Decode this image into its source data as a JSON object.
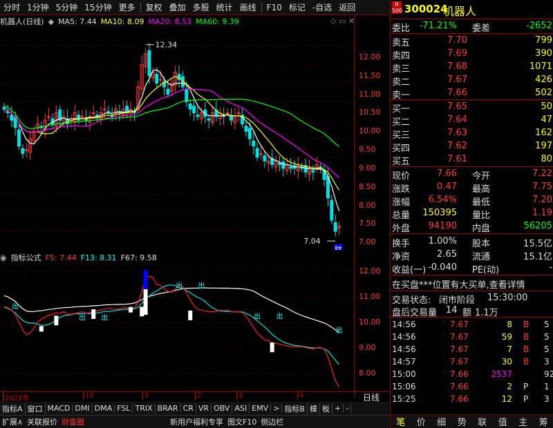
{
  "toolbar": {
    "items": [
      "分时",
      "1分钟",
      "5分钟",
      "15分钟",
      "更多",
      "复权",
      "叠加",
      "多股",
      "统计",
      "画线",
      "F10",
      "标记",
      "-自选",
      "返回"
    ]
  },
  "main_title": {
    "name": "机器人(日线)",
    "ma5": "MA5: 7.44",
    "ma10": "MA10: 8.09",
    "ma20": "MA20: 8.53",
    "ma60": "MA60: 9.39"
  },
  "annotations": {
    "high": "12.34",
    "low": "7.04",
    "cai": "财"
  },
  "ind_title": {
    "name": "指标公式",
    "f5": "F5: 7.44",
    "f13": "F13: 8.31",
    "f67": "F67: 9.58"
  },
  "chu": "出",
  "x_labels": [
    "2021年",
    "12",
    "1",
    "2",
    "3",
    "4"
  ],
  "daily": "日线",
  "tabs": [
    "指标A",
    "窗口",
    "MACD",
    "DMI",
    "DMA",
    "FSL",
    "TRIX",
    "BRAR",
    "CR",
    "VR",
    "OBV",
    "ASI",
    "EMV",
    ">",
    "指标B",
    "模",
    "板",
    "+",
    "-"
  ],
  "bottom": [
    "扩展∧",
    "关联报价",
    "财富圈",
    "新用户福利专享",
    "图文F10",
    "侧边栏"
  ],
  "colors": {
    "up": "#ff3c3c",
    "down": "#00e0e0",
    "ma5": "#ffffff",
    "ma10": "#ffff00",
    "ma20": "#ff00ff",
    "ma60": "#00ff00",
    "axis": "#ff3c3c",
    "blue": "#0000ff"
  },
  "chart_data": [
    {
      "type": "candlestick",
      "title": "机器人(日线)",
      "ylim": [
        6.8,
        12.8
      ],
      "y_ticks": [
        "12.00",
        "11.50",
        "11.00",
        "10.50",
        "10.00",
        "9.50",
        "9.00",
        "8.50",
        "8.00",
        "7.50",
        "7.00"
      ],
      "ma_labels": [
        "MA5: 7.44",
        "MA10: 8.09",
        "MA20: 8.53",
        "MA60: 9.39"
      ],
      "close": [
        10.6,
        10.5,
        10.3,
        10.1,
        9.6,
        9.4,
        9.5,
        9.8,
        10.0,
        10.2,
        10.1,
        10.3,
        10.4,
        10.2,
        10.5,
        10.3,
        10.4,
        10.2,
        10.3,
        10.5,
        10.3,
        10.4,
        10.3,
        10.4,
        10.5,
        10.4,
        10.5,
        10.6,
        10.5,
        10.4,
        10.6,
        10.5,
        10.6,
        10.5,
        10.6,
        10.5,
        11.2,
        11.8,
        12.1,
        11.5,
        11.6,
        11.3,
        11.4,
        11.2,
        11.0,
        11.3,
        11.6,
        11.4,
        11.2,
        10.8,
        10.6,
        10.5,
        10.4,
        10.5,
        10.4,
        10.3,
        10.5,
        10.4,
        10.5,
        10.4,
        10.5,
        10.3,
        10.4,
        10.5,
        10.2,
        10.0,
        9.8,
        9.6,
        9.3,
        9.4,
        9.2,
        9.2,
        9.1,
        9.2,
        9.1,
        9.0,
        9.1,
        9.0,
        9.0,
        9.1,
        9.0,
        8.9,
        9.0,
        8.9,
        9.1,
        9.0,
        8.7,
        8.2,
        7.6,
        7.3,
        7.44
      ]
    },
    {
      "type": "line",
      "title": "指标公式",
      "ylim": [
        7.3,
        12.3
      ],
      "y_ticks": [
        "12.00",
        "11.00",
        "10.00",
        "9.00",
        "8.00"
      ],
      "series": [
        {
          "name": "F5: 7.44"
        },
        {
          "name": "F13: 8.31"
        },
        {
          "name": "F67: 9.58"
        }
      ]
    }
  ],
  "quote": {
    "stock_code": "300024",
    "stock_name": "机器人",
    "badge_r": "R",
    "badge_num": "500",
    "weibi_label": "委比",
    "weibi": "-71.21%",
    "weicha_label": "委差",
    "weicha": "-2652",
    "asks": [
      {
        "l": "卖五",
        "p": "7.70",
        "v": "799"
      },
      {
        "l": "卖四",
        "p": "7.69",
        "v": "390"
      },
      {
        "l": "卖三",
        "p": "7.68",
        "v": "1071"
      },
      {
        "l": "卖二",
        "p": "7.67",
        "v": "426"
      },
      {
        "l": "卖一",
        "p": "7.66",
        "v": "502"
      }
    ],
    "bids": [
      {
        "l": "买一",
        "p": "7.65",
        "v": "50"
      },
      {
        "l": "买二",
        "p": "7.64",
        "v": "47"
      },
      {
        "l": "买三",
        "p": "7.63",
        "v": "162"
      },
      {
        "l": "买四",
        "p": "7.62",
        "v": "197"
      },
      {
        "l": "买五",
        "p": "7.61",
        "v": "80"
      }
    ],
    "stats": [
      {
        "l1": "现价",
        "v1": "7.66",
        "c1": "red",
        "l2": "今开",
        "v2": "7.22",
        "c2": "red"
      },
      {
        "l1": "涨跌",
        "v1": "0.47",
        "c1": "red",
        "l2": "最高",
        "v2": "7.75",
        "c2": "red"
      },
      {
        "l1": "涨幅",
        "v1": "6.54%",
        "c1": "red",
        "l2": "最低",
        "v2": "7.20",
        "c2": "red"
      },
      {
        "l1": "总量",
        "v1": "150395",
        "c1": "yel",
        "l2": "量比",
        "v2": "1.19",
        "c2": "red"
      },
      {
        "l1": "外盘",
        "v1": "94190",
        "c1": "red",
        "l2": "内盘",
        "v2": "56205",
        "c2": "grn"
      }
    ],
    "stats2": [
      {
        "l1": "换手",
        "v1": "1.00%",
        "l2": "股本",
        "v2": "15.5亿"
      },
      {
        "l1": "净资",
        "v1": "2.65",
        "l2": "流通",
        "v2": "15.1亿"
      },
      {
        "l1": "收益(一)",
        "v1": "-0.040",
        "l2": "PE(动)",
        "v2": "-"
      }
    ],
    "news": "在买盘***位置有大买单,查看详情",
    "status_label": "交易状态:",
    "status": "闭市阶段",
    "status_time": "15:30:00",
    "after_label": "盘后交易量",
    "after_val": "14",
    "after_amt_label": "额",
    "after_amt": "1.1万",
    "trades": [
      {
        "t": "14:56",
        "p": "7.67",
        "v": "8",
        "s": "B",
        "n": "5"
      },
      {
        "t": "14:56",
        "p": "7.67",
        "v": "59",
        "s": "B",
        "n": "5"
      },
      {
        "t": "14:56",
        "p": "7.67",
        "v": "7",
        "s": "B",
        "n": "5"
      },
      {
        "t": "14:57",
        "p": "7.67",
        "v": "30",
        "s": "B",
        "n": "3"
      },
      {
        "t": "15:00",
        "p": "7.66",
        "v": "2537",
        "s": "",
        "n": "92"
      },
      {
        "t": "15:06",
        "p": "7.66",
        "v": "2",
        "s": "P",
        "n": "1"
      },
      {
        "t": "15:25",
        "p": "7.66",
        "v": "12",
        "s": "P",
        "n": "3"
      }
    ],
    "nav": [
      "笔",
      "价",
      "细",
      "势",
      "联",
      "值",
      "主",
      "筹"
    ]
  }
}
